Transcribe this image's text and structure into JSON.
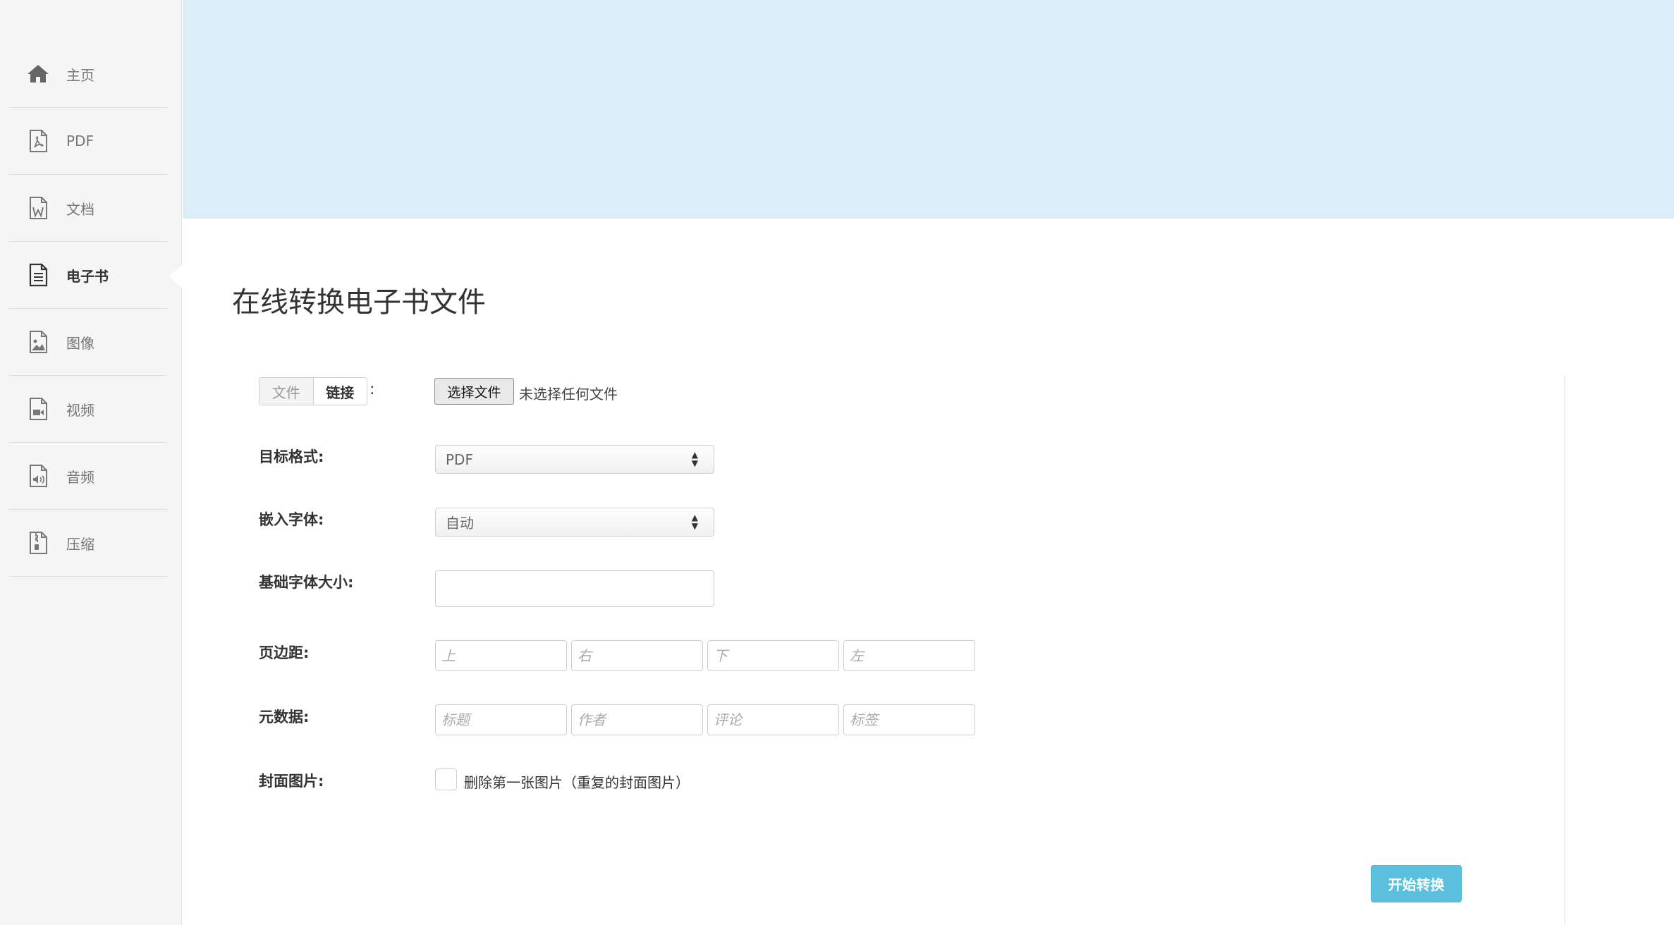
{
  "sidebar": {
    "items": [
      {
        "label": "主页",
        "icon": "home-icon"
      },
      {
        "label": "PDF",
        "icon": "pdf-file-icon"
      },
      {
        "label": "文档",
        "icon": "word-file-icon"
      },
      {
        "label": "电子书",
        "icon": "ebook-file-icon",
        "active": true
      },
      {
        "label": "图像",
        "icon": "image-file-icon"
      },
      {
        "label": "视频",
        "icon": "video-file-icon"
      },
      {
        "label": "音频",
        "icon": "audio-file-icon"
      },
      {
        "label": "压缩",
        "icon": "archive-file-icon"
      }
    ]
  },
  "page": {
    "title": "在线转换电子书文件"
  },
  "form": {
    "source": {
      "tab_file": "文件",
      "tab_link": "链接",
      "colon": ":",
      "choose_button": "选择文件",
      "no_file_text": "未选择任何文件"
    },
    "target_format": {
      "label": "目标格式:",
      "value": "PDF"
    },
    "embed_font": {
      "label": "嵌入字体:",
      "value": "自动"
    },
    "base_font_size": {
      "label": "基础字体大小:",
      "value": ""
    },
    "margins": {
      "label": "页边距:",
      "top_placeholder": "上",
      "right_placeholder": "右",
      "bottom_placeholder": "下",
      "left_placeholder": "左"
    },
    "metadata": {
      "label": "元数据:",
      "title_placeholder": "标题",
      "author_placeholder": "作者",
      "comment_placeholder": "评论",
      "tags_placeholder": "标签"
    },
    "cover": {
      "label": "封面图片:",
      "checkbox_label": "删除第一张图片（重复的封面图片）"
    },
    "submit_label": "开始转换"
  },
  "colors": {
    "banner": "#dbedf6",
    "sidebar": "#f5f5f5",
    "submit": "#5bc0de"
  }
}
